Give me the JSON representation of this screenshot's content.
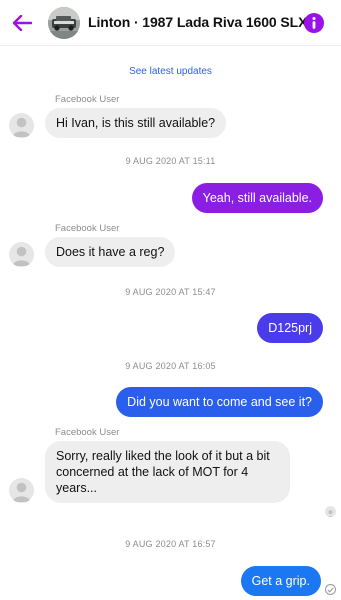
{
  "header": {
    "title": "Linton · 1987 Lada Riva 1600 SLX",
    "back_icon": "back-arrow-icon",
    "info_icon": "info-icon",
    "accent_color": "#9b12e8"
  },
  "see_latest": "See latest updates",
  "messages": [
    {
      "sender": "Facebook User",
      "text": "Hi Ivan, is this still available?"
    },
    {
      "timestamp": "9 AUG 2020 AT 15:11"
    },
    {
      "text": "Yeah, still available.",
      "color": "#8a1fe3"
    },
    {
      "sender": "Facebook User",
      "text": "Does it have a reg?"
    },
    {
      "timestamp": "9 AUG 2020 AT 15:47"
    },
    {
      "text": "D125prj",
      "color": "#4a3ceb"
    },
    {
      "timestamp": "9 AUG 2020 AT 16:05"
    },
    {
      "text": "Did you want to come and see it?",
      "color": "#2a5fec"
    },
    {
      "sender": "Facebook User",
      "text": "Sorry, really liked the look of it but a bit concerned at the lack of MOT for 4 years..."
    },
    {
      "timestamp": "9 AUG 2020 AT 16:57"
    },
    {
      "text": "Get a grip.",
      "color": "#1b78f2"
    }
  ]
}
